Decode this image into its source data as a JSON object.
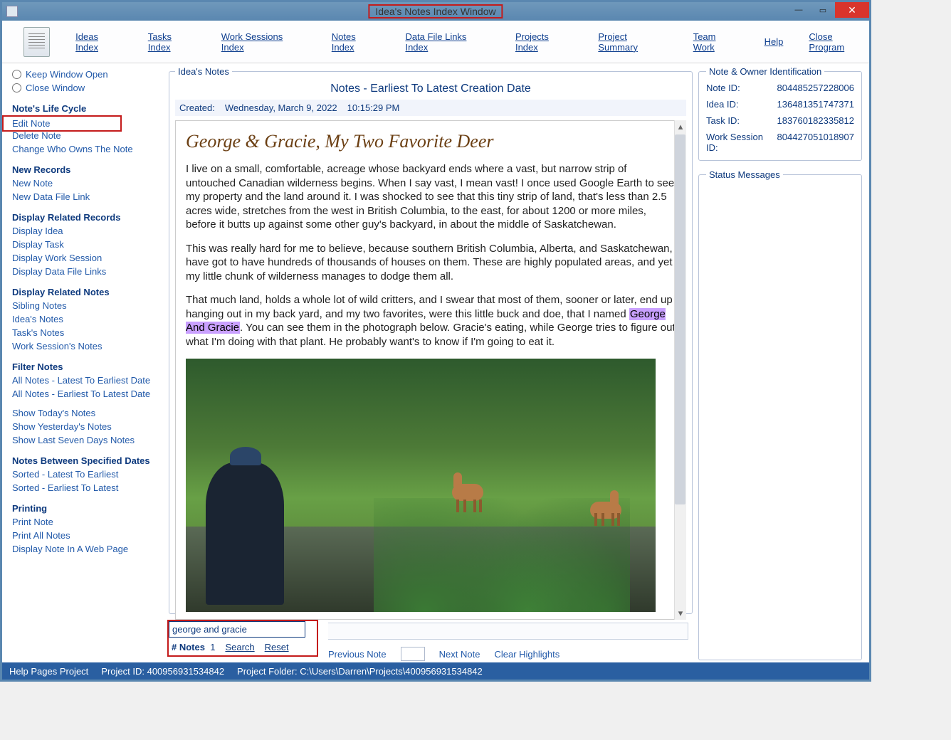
{
  "window_title": "Idea's Notes Index Window",
  "menubar": {
    "ideas_index": "Ideas Index",
    "tasks_index": "Tasks Index",
    "work_sessions_index": "Work Sessions Index",
    "notes_index": "Notes Index",
    "data_file_links_index": "Data File Links Index",
    "projects_index": "Projects Index",
    "project_summary": "Project Summary",
    "team_work": "Team Work",
    "help": "Help",
    "close_program": "Close Program"
  },
  "sidebar": {
    "keep_window_open": "Keep Window Open",
    "close_window": "Close Window",
    "notes_life_cycle": {
      "heading": "Note's Life Cycle",
      "edit_note": "Edit Note",
      "delete_note": "Delete Note",
      "change_owner": "Change Who Owns The Note"
    },
    "new_records": {
      "heading": "New Records",
      "new_note": "New Note",
      "new_data_file_link": "New Data File Link"
    },
    "display_related_records": {
      "heading": "Display Related Records",
      "display_idea": "Display Idea",
      "display_task": "Display Task",
      "display_work_session": "Display Work Session",
      "display_data_file_links": "Display Data File Links"
    },
    "display_related_notes": {
      "heading": "Display Related Notes",
      "sibling_notes": "Sibling Notes",
      "ideas_notes": "Idea's Notes",
      "tasks_notes": "Task's Notes",
      "work_sessions_notes": "Work Session's Notes"
    },
    "filter_notes": {
      "heading": "Filter Notes",
      "latest_to_earliest": "All Notes - Latest To Earliest Date",
      "earliest_to_latest": "All Notes - Earliest To Latest Date",
      "show_today": "Show Today's Notes",
      "show_yesterday": "Show Yesterday's Notes",
      "show_last_seven": "Show Last Seven Days Notes"
    },
    "notes_between": {
      "heading": "Notes Between Specified Dates",
      "sorted_latest": "Sorted - Latest To Earliest",
      "sorted_earliest": "Sorted - Earliest To Latest"
    },
    "printing": {
      "heading": "Printing",
      "print_note": "Print Note",
      "print_all_notes": "Print All Notes",
      "display_in_web": "Display Note In A Web Page"
    }
  },
  "note_panel": {
    "legend": "Idea's Notes",
    "title": "Notes - Earliest To Latest Creation Date",
    "created_label": "Created:",
    "created_date": "Wednesday, March 9, 2022",
    "created_time": "10:15:29 PM",
    "heading": "George & Gracie, My Two Favorite Deer",
    "para1": "I live on a small, comfortable, acreage whose backyard ends where a vast, but narrow strip of untouched Canadian wilderness begins. When I say vast, I mean vast! I once used Google Earth to see my property and the land around it. I was shocked to see that this tiny strip of land, that's less than 2.5 acres wide, stretches from the west in British Columbia, to the east, for about 1200 or more miles, before it butts up against some other guy's backyard, in about the middle of Saskatchewan.",
    "para2": "This was really hard for me to believe, because southern British Columbia, Alberta, and Saskatchewan, have got to have hundreds of thousands of houses on them. These are highly populated areas, and yet my little chunk of wilderness manages to dodge them all.",
    "para3a": "That much land, holds a whole lot of wild critters, and I swear that most of them, sooner or later, end up hanging out in my back yard, and my two favorites, were this little buck and doe, that I named ",
    "para3_highlight": "George And Gracie",
    "para3b": ". You can see them in the photograph below. Gracie's eating, while George tries to figure out what I'm doing with that plant. He probably want's to know if I'm going to eat it."
  },
  "search": {
    "value": "george and gracie",
    "notes_label": "# Notes",
    "notes_count": "1",
    "search": "Search",
    "reset": "Reset",
    "prev": "Previous Note",
    "next": "Next Note",
    "clear": "Clear Highlights"
  },
  "identification": {
    "legend": "Note & Owner Identification",
    "note_id_label": "Note ID:",
    "note_id": "804485257228006",
    "idea_id_label": "Idea ID:",
    "idea_id": "136481351747371",
    "task_id_label": "Task ID:",
    "task_id": "183760182335812",
    "ws_id_label": "Work Session ID:",
    "ws_id": "804427051018907"
  },
  "status_legend": "Status Messages",
  "statusbar": {
    "help_pages": "Help Pages Project",
    "project_id_label": "Project ID:",
    "project_id": "400956931534842",
    "project_folder_label": "Project Folder:",
    "project_folder": "C:\\Users\\Darren\\Projects\\400956931534842"
  }
}
